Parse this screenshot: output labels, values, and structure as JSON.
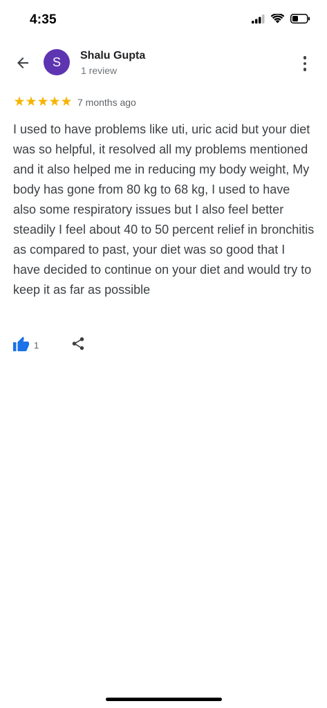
{
  "status_bar": {
    "time": "4:35",
    "icons": [
      "cellular-signal-icon",
      "wifi-icon",
      "battery-icon"
    ]
  },
  "header": {
    "back_icon": "arrow-left-icon",
    "avatar_initial": "S",
    "avatar_color": "#5e35b1",
    "reviewer_name": "Shalu Gupta",
    "review_count": "1 review",
    "more_icon": "more-vertical-icon"
  },
  "review": {
    "rating": 5,
    "rating_max": 5,
    "star_color": "#f5b400",
    "date": "7 months ago",
    "text": "I used to have problems like uti, uric acid but your diet was so helpful, it resolved all my problems mentioned and it also helped me in reducing my body weight, My body has gone from 80 kg to 68 kg, I used to have also some respiratory issues but I also feel better steadily I feel about 40 to 50 percent relief in bronchitis as compared to past, your diet was so good that I have decided to continue on your diet and would try to keep it as far as possible"
  },
  "actions": {
    "like_icon": "thumbs-up-icon",
    "like_count": "1",
    "like_color": "#1a73e8",
    "share_icon": "share-icon"
  }
}
